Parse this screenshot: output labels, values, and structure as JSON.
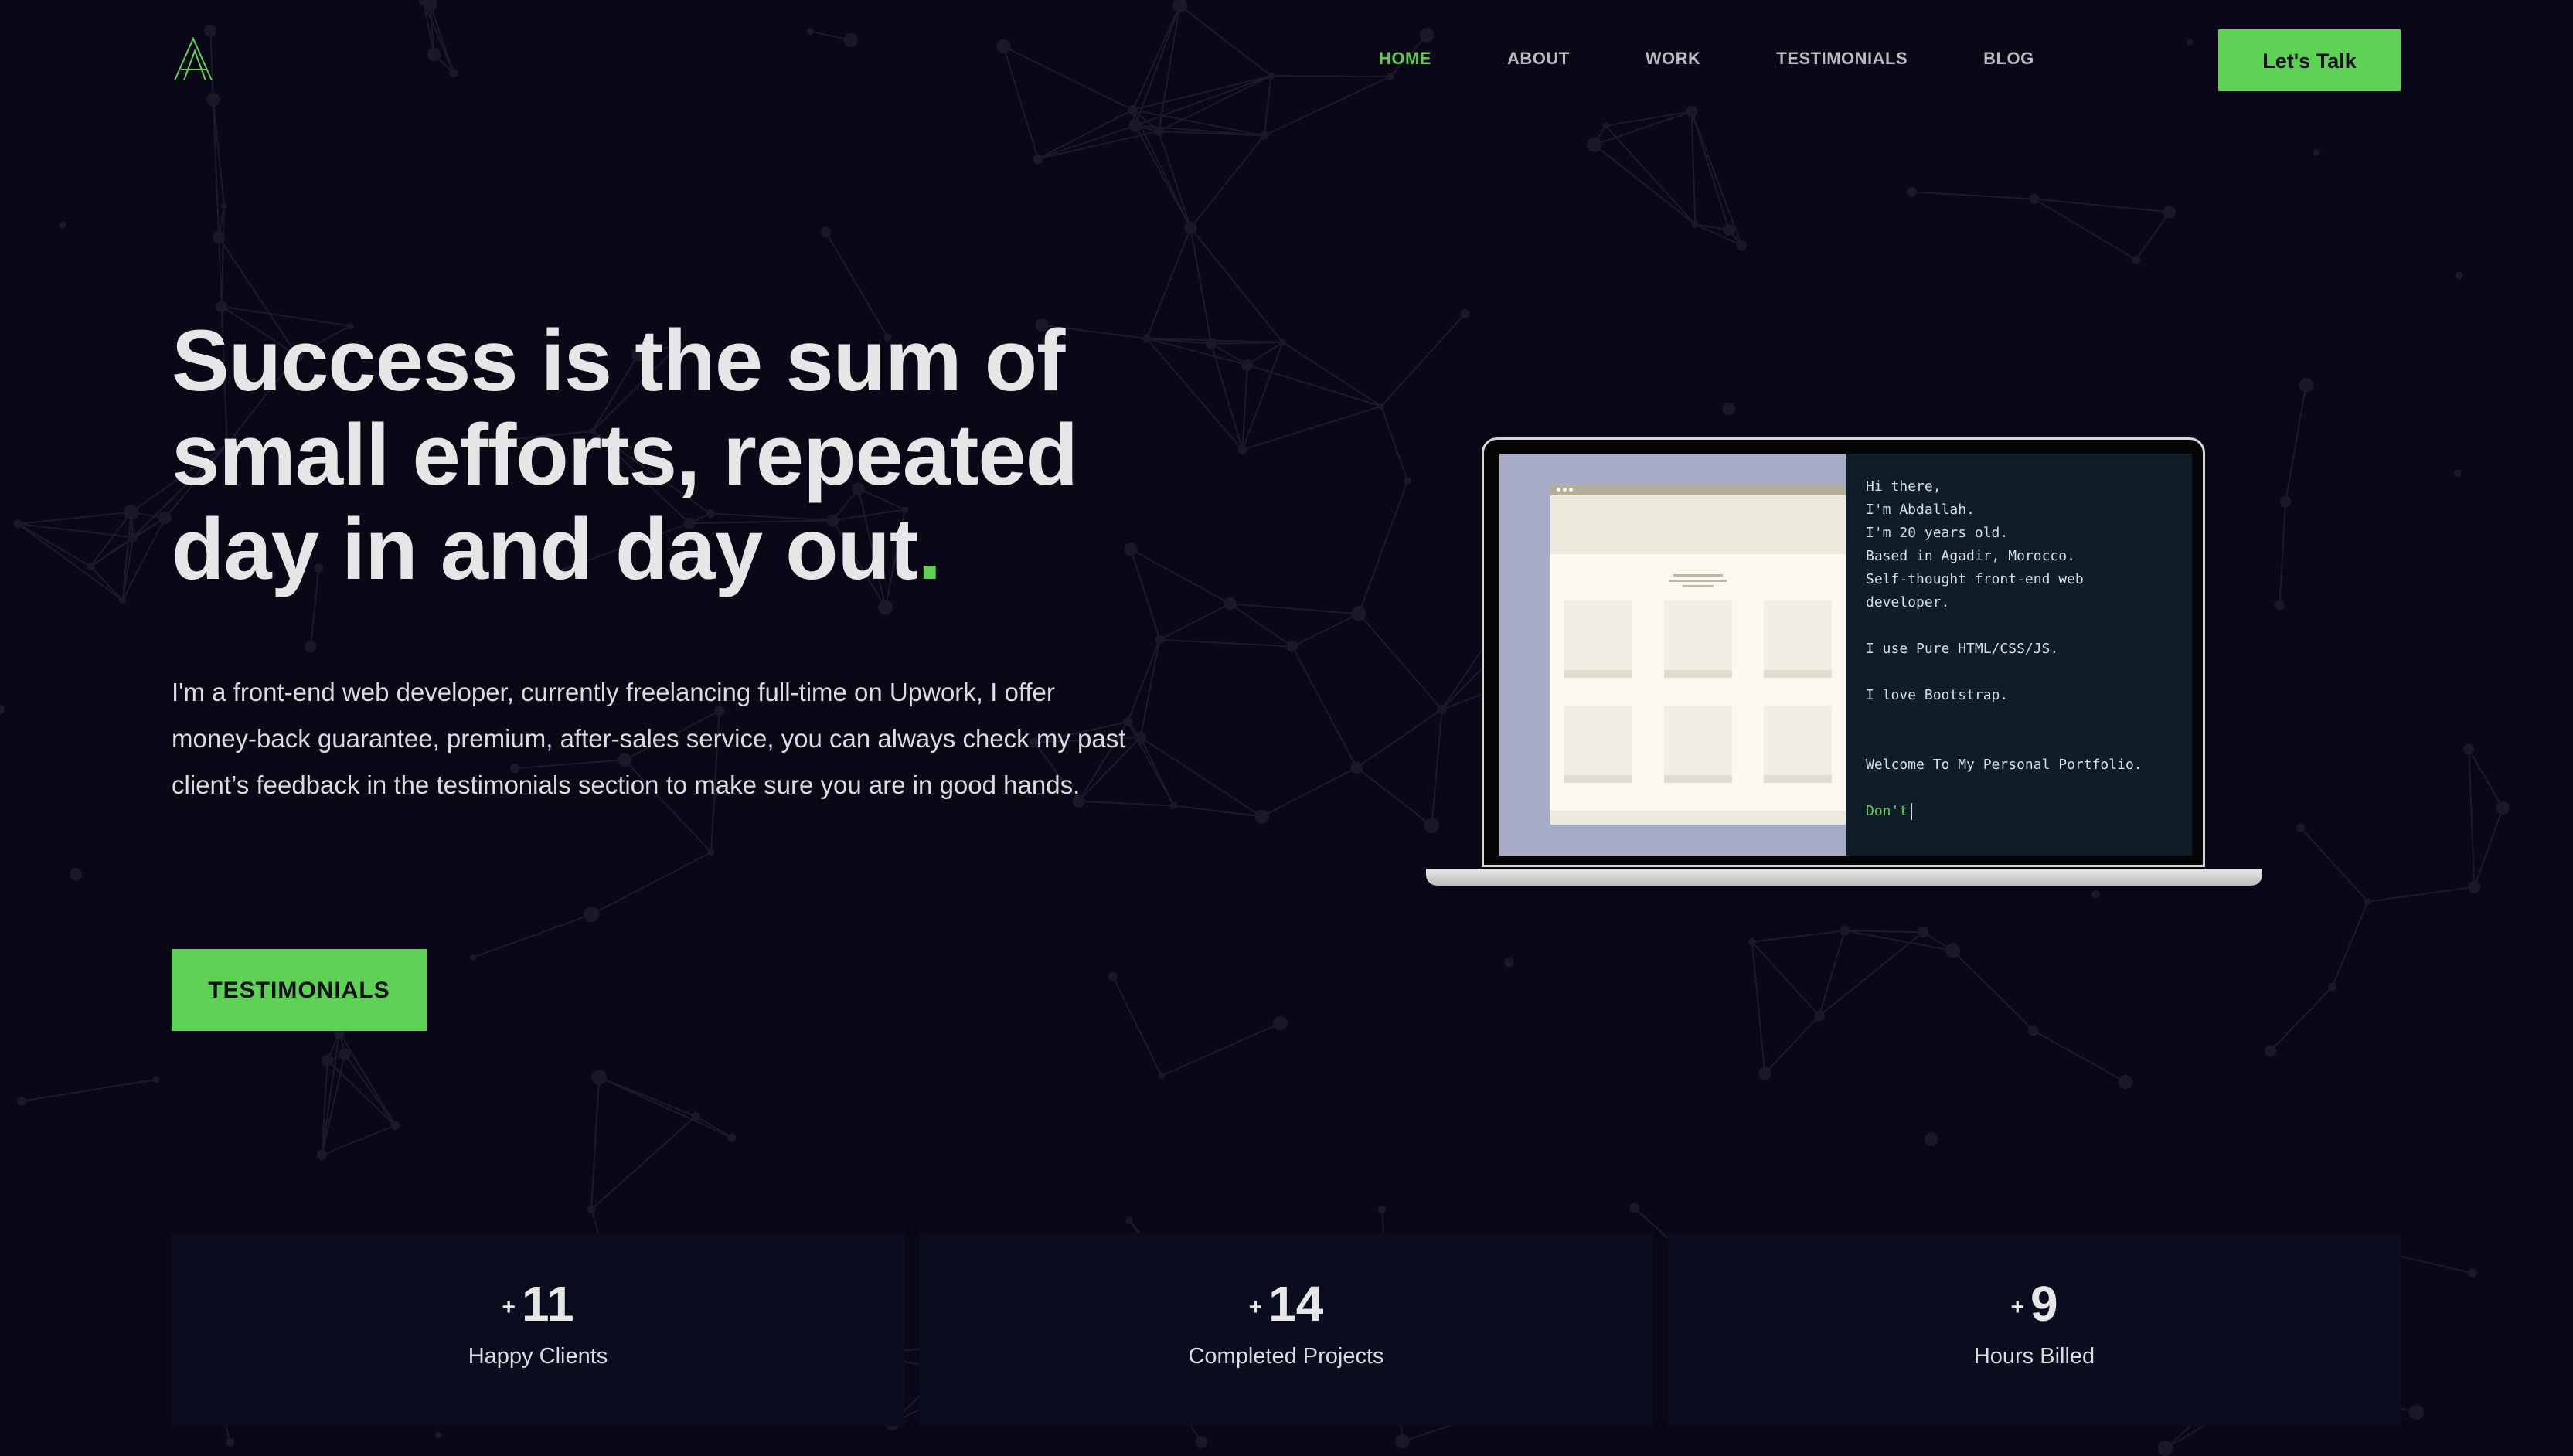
{
  "nav": {
    "items": [
      {
        "label": "HOME",
        "active": true
      },
      {
        "label": "ABOUT",
        "active": false
      },
      {
        "label": "WORK",
        "active": false
      },
      {
        "label": "TESTIMONIALS",
        "active": false
      },
      {
        "label": "BLOG",
        "active": false
      }
    ],
    "cta_label": "Let's Talk"
  },
  "hero": {
    "headline": "Success is the sum of small efforts, repeated day in and day out",
    "headline_dot": ".",
    "intro": "I'm a front-end web developer, currently freelancing full-time on Upwork, I offer money-back guarantee, premium, after-sales service, you can always check my past client’s feedback in the testimonials section to make sure you are in good hands.",
    "cta_label": "TESTIMONIALS"
  },
  "terminal": {
    "lines": [
      "Hi there,",
      "I'm Abdallah.",
      "I'm 20 years old.",
      "Based in Agadir, Morocco.",
      "Self-thought front-end web",
      "developer.",
      "",
      "I use Pure HTML/CSS/JS.",
      "",
      "I love Bootstrap.",
      "",
      "",
      "Welcome To My Personal Portfolio.",
      ""
    ],
    "typing": "Don't"
  },
  "stats": [
    {
      "prefix": "+",
      "value": "11",
      "label": "Happy Clients"
    },
    {
      "prefix": "+",
      "value": "14",
      "label": "Completed Projects"
    },
    {
      "prefix": "+",
      "value": "9",
      "label": "Hours Billed"
    }
  ],
  "colors": {
    "background": "#0a0817",
    "accent": "#5dd255",
    "text": "#e6e6e6",
    "stat_card": "#0a0d1d",
    "terminal_bg": "#0f1d29"
  },
  "icons": {
    "logo": "a-monogram-logo"
  }
}
